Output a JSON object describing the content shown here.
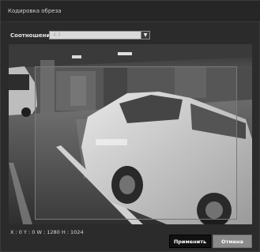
{
  "dialog": {
    "title": "Кодировка обреза",
    "ratio_label": "Соотношение",
    "ratio_value": "4:3",
    "coords": "X : 0 Y : 0 W : 1280 H : 1024",
    "apply_label": "Применить",
    "cancel_label": "Отмена"
  }
}
